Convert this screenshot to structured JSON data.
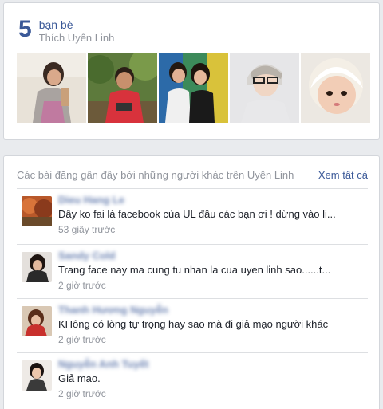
{
  "friends": {
    "count": "5",
    "title": "bạn bè",
    "subtitle": "Thích Uyên Linh",
    "photos": [
      "friend-photo-1",
      "friend-photo-2",
      "friend-photo-3",
      "friend-photo-4",
      "friend-photo-5"
    ]
  },
  "posts": {
    "header": "Các bài đăng gần đây bởi những người khác trên Uyên Linh",
    "see_all": "Xem tất cả",
    "items": [
      {
        "name": "Dieu Hang Le",
        "text": "Đây ko fai là facebook của UL đâu các bạn ơi ! dừng vào li...",
        "time": "53 giây trước"
      },
      {
        "name": "Sandy Cold",
        "text": "Trang face nay ma cung tu nhan la cua uyen linh sao......t...",
        "time": "2 giờ trước"
      },
      {
        "name": "Thanh Hương Nguyễn",
        "text": "KHông có lòng tự trọng hay sao mà đi giả mạo người khác",
        "time": "2 giờ trước"
      },
      {
        "name": "Nguyễn Anh Tuyết",
        "text": "Giả mạo.",
        "time": "2 giờ trước"
      }
    ]
  },
  "colors": {
    "link": "#3b5998",
    "muted": "#90949c",
    "background": "#e9ebee"
  }
}
